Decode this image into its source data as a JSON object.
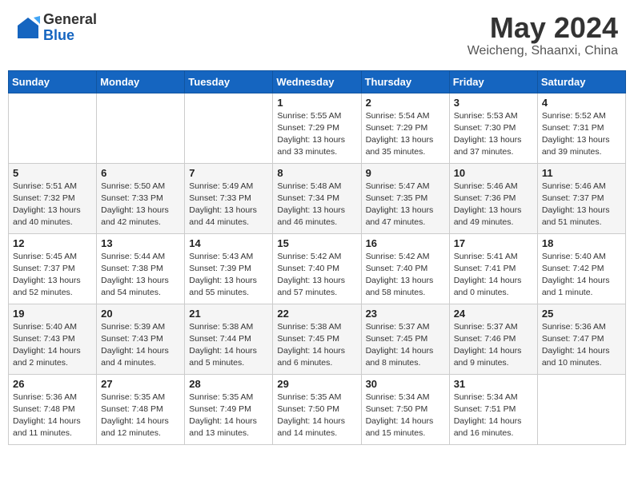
{
  "header": {
    "logo_general": "General",
    "logo_blue": "Blue",
    "month": "May 2024",
    "location": "Weicheng, Shaanxi, China"
  },
  "days_of_week": [
    "Sunday",
    "Monday",
    "Tuesday",
    "Wednesday",
    "Thursday",
    "Friday",
    "Saturday"
  ],
  "weeks": [
    [
      {
        "day": "",
        "content": ""
      },
      {
        "day": "",
        "content": ""
      },
      {
        "day": "",
        "content": ""
      },
      {
        "day": "1",
        "content": "Sunrise: 5:55 AM\nSunset: 7:29 PM\nDaylight: 13 hours and 33 minutes."
      },
      {
        "day": "2",
        "content": "Sunrise: 5:54 AM\nSunset: 7:29 PM\nDaylight: 13 hours and 35 minutes."
      },
      {
        "day": "3",
        "content": "Sunrise: 5:53 AM\nSunset: 7:30 PM\nDaylight: 13 hours and 37 minutes."
      },
      {
        "day": "4",
        "content": "Sunrise: 5:52 AM\nSunset: 7:31 PM\nDaylight: 13 hours and 39 minutes."
      }
    ],
    [
      {
        "day": "5",
        "content": "Sunrise: 5:51 AM\nSunset: 7:32 PM\nDaylight: 13 hours and 40 minutes."
      },
      {
        "day": "6",
        "content": "Sunrise: 5:50 AM\nSunset: 7:33 PM\nDaylight: 13 hours and 42 minutes."
      },
      {
        "day": "7",
        "content": "Sunrise: 5:49 AM\nSunset: 7:33 PM\nDaylight: 13 hours and 44 minutes."
      },
      {
        "day": "8",
        "content": "Sunrise: 5:48 AM\nSunset: 7:34 PM\nDaylight: 13 hours and 46 minutes."
      },
      {
        "day": "9",
        "content": "Sunrise: 5:47 AM\nSunset: 7:35 PM\nDaylight: 13 hours and 47 minutes."
      },
      {
        "day": "10",
        "content": "Sunrise: 5:46 AM\nSunset: 7:36 PM\nDaylight: 13 hours and 49 minutes."
      },
      {
        "day": "11",
        "content": "Sunrise: 5:46 AM\nSunset: 7:37 PM\nDaylight: 13 hours and 51 minutes."
      }
    ],
    [
      {
        "day": "12",
        "content": "Sunrise: 5:45 AM\nSunset: 7:37 PM\nDaylight: 13 hours and 52 minutes."
      },
      {
        "day": "13",
        "content": "Sunrise: 5:44 AM\nSunset: 7:38 PM\nDaylight: 13 hours and 54 minutes."
      },
      {
        "day": "14",
        "content": "Sunrise: 5:43 AM\nSunset: 7:39 PM\nDaylight: 13 hours and 55 minutes."
      },
      {
        "day": "15",
        "content": "Sunrise: 5:42 AM\nSunset: 7:40 PM\nDaylight: 13 hours and 57 minutes."
      },
      {
        "day": "16",
        "content": "Sunrise: 5:42 AM\nSunset: 7:40 PM\nDaylight: 13 hours and 58 minutes."
      },
      {
        "day": "17",
        "content": "Sunrise: 5:41 AM\nSunset: 7:41 PM\nDaylight: 14 hours and 0 minutes."
      },
      {
        "day": "18",
        "content": "Sunrise: 5:40 AM\nSunset: 7:42 PM\nDaylight: 14 hours and 1 minute."
      }
    ],
    [
      {
        "day": "19",
        "content": "Sunrise: 5:40 AM\nSunset: 7:43 PM\nDaylight: 14 hours and 2 minutes."
      },
      {
        "day": "20",
        "content": "Sunrise: 5:39 AM\nSunset: 7:43 PM\nDaylight: 14 hours and 4 minutes."
      },
      {
        "day": "21",
        "content": "Sunrise: 5:38 AM\nSunset: 7:44 PM\nDaylight: 14 hours and 5 minutes."
      },
      {
        "day": "22",
        "content": "Sunrise: 5:38 AM\nSunset: 7:45 PM\nDaylight: 14 hours and 6 minutes."
      },
      {
        "day": "23",
        "content": "Sunrise: 5:37 AM\nSunset: 7:45 PM\nDaylight: 14 hours and 8 minutes."
      },
      {
        "day": "24",
        "content": "Sunrise: 5:37 AM\nSunset: 7:46 PM\nDaylight: 14 hours and 9 minutes."
      },
      {
        "day": "25",
        "content": "Sunrise: 5:36 AM\nSunset: 7:47 PM\nDaylight: 14 hours and 10 minutes."
      }
    ],
    [
      {
        "day": "26",
        "content": "Sunrise: 5:36 AM\nSunset: 7:48 PM\nDaylight: 14 hours and 11 minutes."
      },
      {
        "day": "27",
        "content": "Sunrise: 5:35 AM\nSunset: 7:48 PM\nDaylight: 14 hours and 12 minutes."
      },
      {
        "day": "28",
        "content": "Sunrise: 5:35 AM\nSunset: 7:49 PM\nDaylight: 14 hours and 13 minutes."
      },
      {
        "day": "29",
        "content": "Sunrise: 5:35 AM\nSunset: 7:50 PM\nDaylight: 14 hours and 14 minutes."
      },
      {
        "day": "30",
        "content": "Sunrise: 5:34 AM\nSunset: 7:50 PM\nDaylight: 14 hours and 15 minutes."
      },
      {
        "day": "31",
        "content": "Sunrise: 5:34 AM\nSunset: 7:51 PM\nDaylight: 14 hours and 16 minutes."
      },
      {
        "day": "",
        "content": ""
      }
    ]
  ]
}
